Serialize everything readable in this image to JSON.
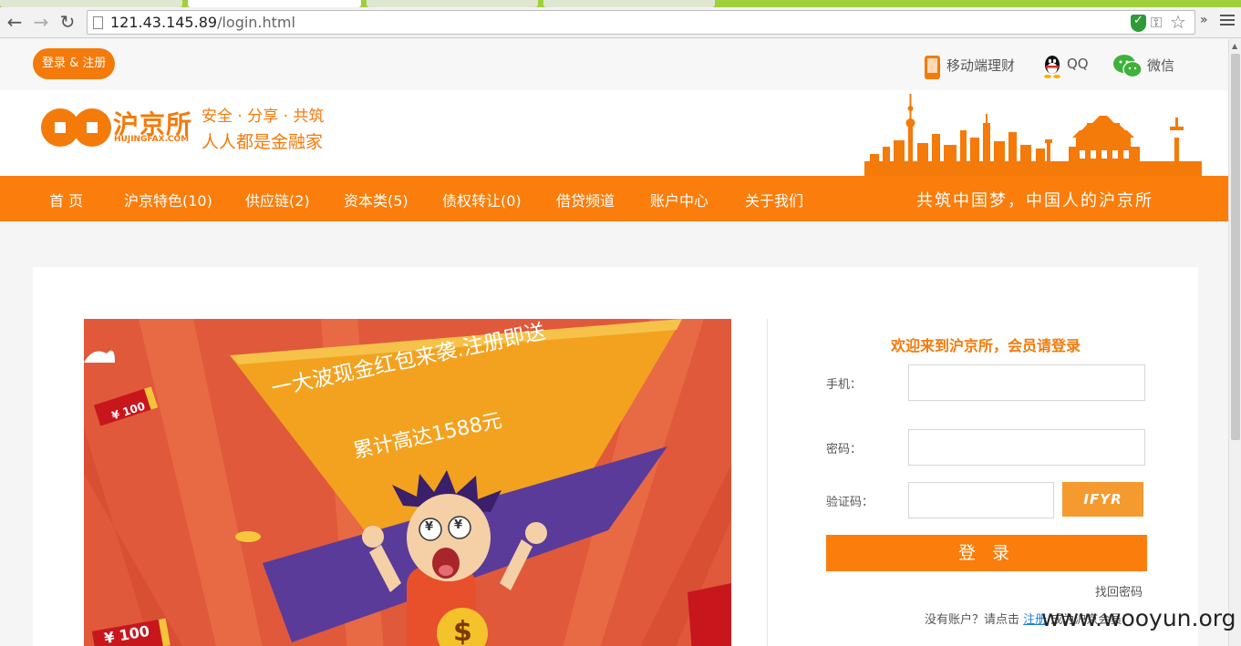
{
  "browser": {
    "url_host": "121.43.145.89",
    "url_path": "/login.html",
    "more_label": "»"
  },
  "topbar": {
    "login_register": "登录 & 注册",
    "mobile_finance": "移动端理财",
    "qq": "QQ",
    "wechat": "微信"
  },
  "header": {
    "logo_text": "沪京所",
    "logo_sub": "HUJINGFAX.COM",
    "slogan_line1": "安全 · 分享 · 共筑",
    "slogan_line2": "人人都是金融家"
  },
  "nav": {
    "items": [
      "首 页",
      "沪京特色(10)",
      "供应链(2)",
      "资本类(5)",
      "债权转让(0)",
      "借贷频道",
      "账户中心",
      "关于我们"
    ],
    "motto": "共筑中国梦，中国人的沪京所"
  },
  "banner": {
    "headline": "一大波现金红包来袭.注册即送",
    "subline": "累计高达1588元",
    "packet_label_1": "¥ 100",
    "packet_label_2": "¥ 100",
    "coin_symbol": "$",
    "eye_symbol": "¥"
  },
  "login": {
    "welcome": "欢迎来到沪京所，会员请登录",
    "phone_label": "手机：",
    "password_label": "密码：",
    "captcha_label": "验证码：",
    "captcha_text": "IFYR",
    "submit": "登 录",
    "forgot": "找回密码",
    "no_account": "没有账户？请点击",
    "register_link": "注册",
    "register_suffix": "成为沪京会员"
  },
  "watermark": "www.wooyun.org",
  "colors": {
    "brand_orange": "#fb7d0b",
    "link_blue": "#1e7fd8",
    "tab_strip_green": "#9fcf3a"
  }
}
